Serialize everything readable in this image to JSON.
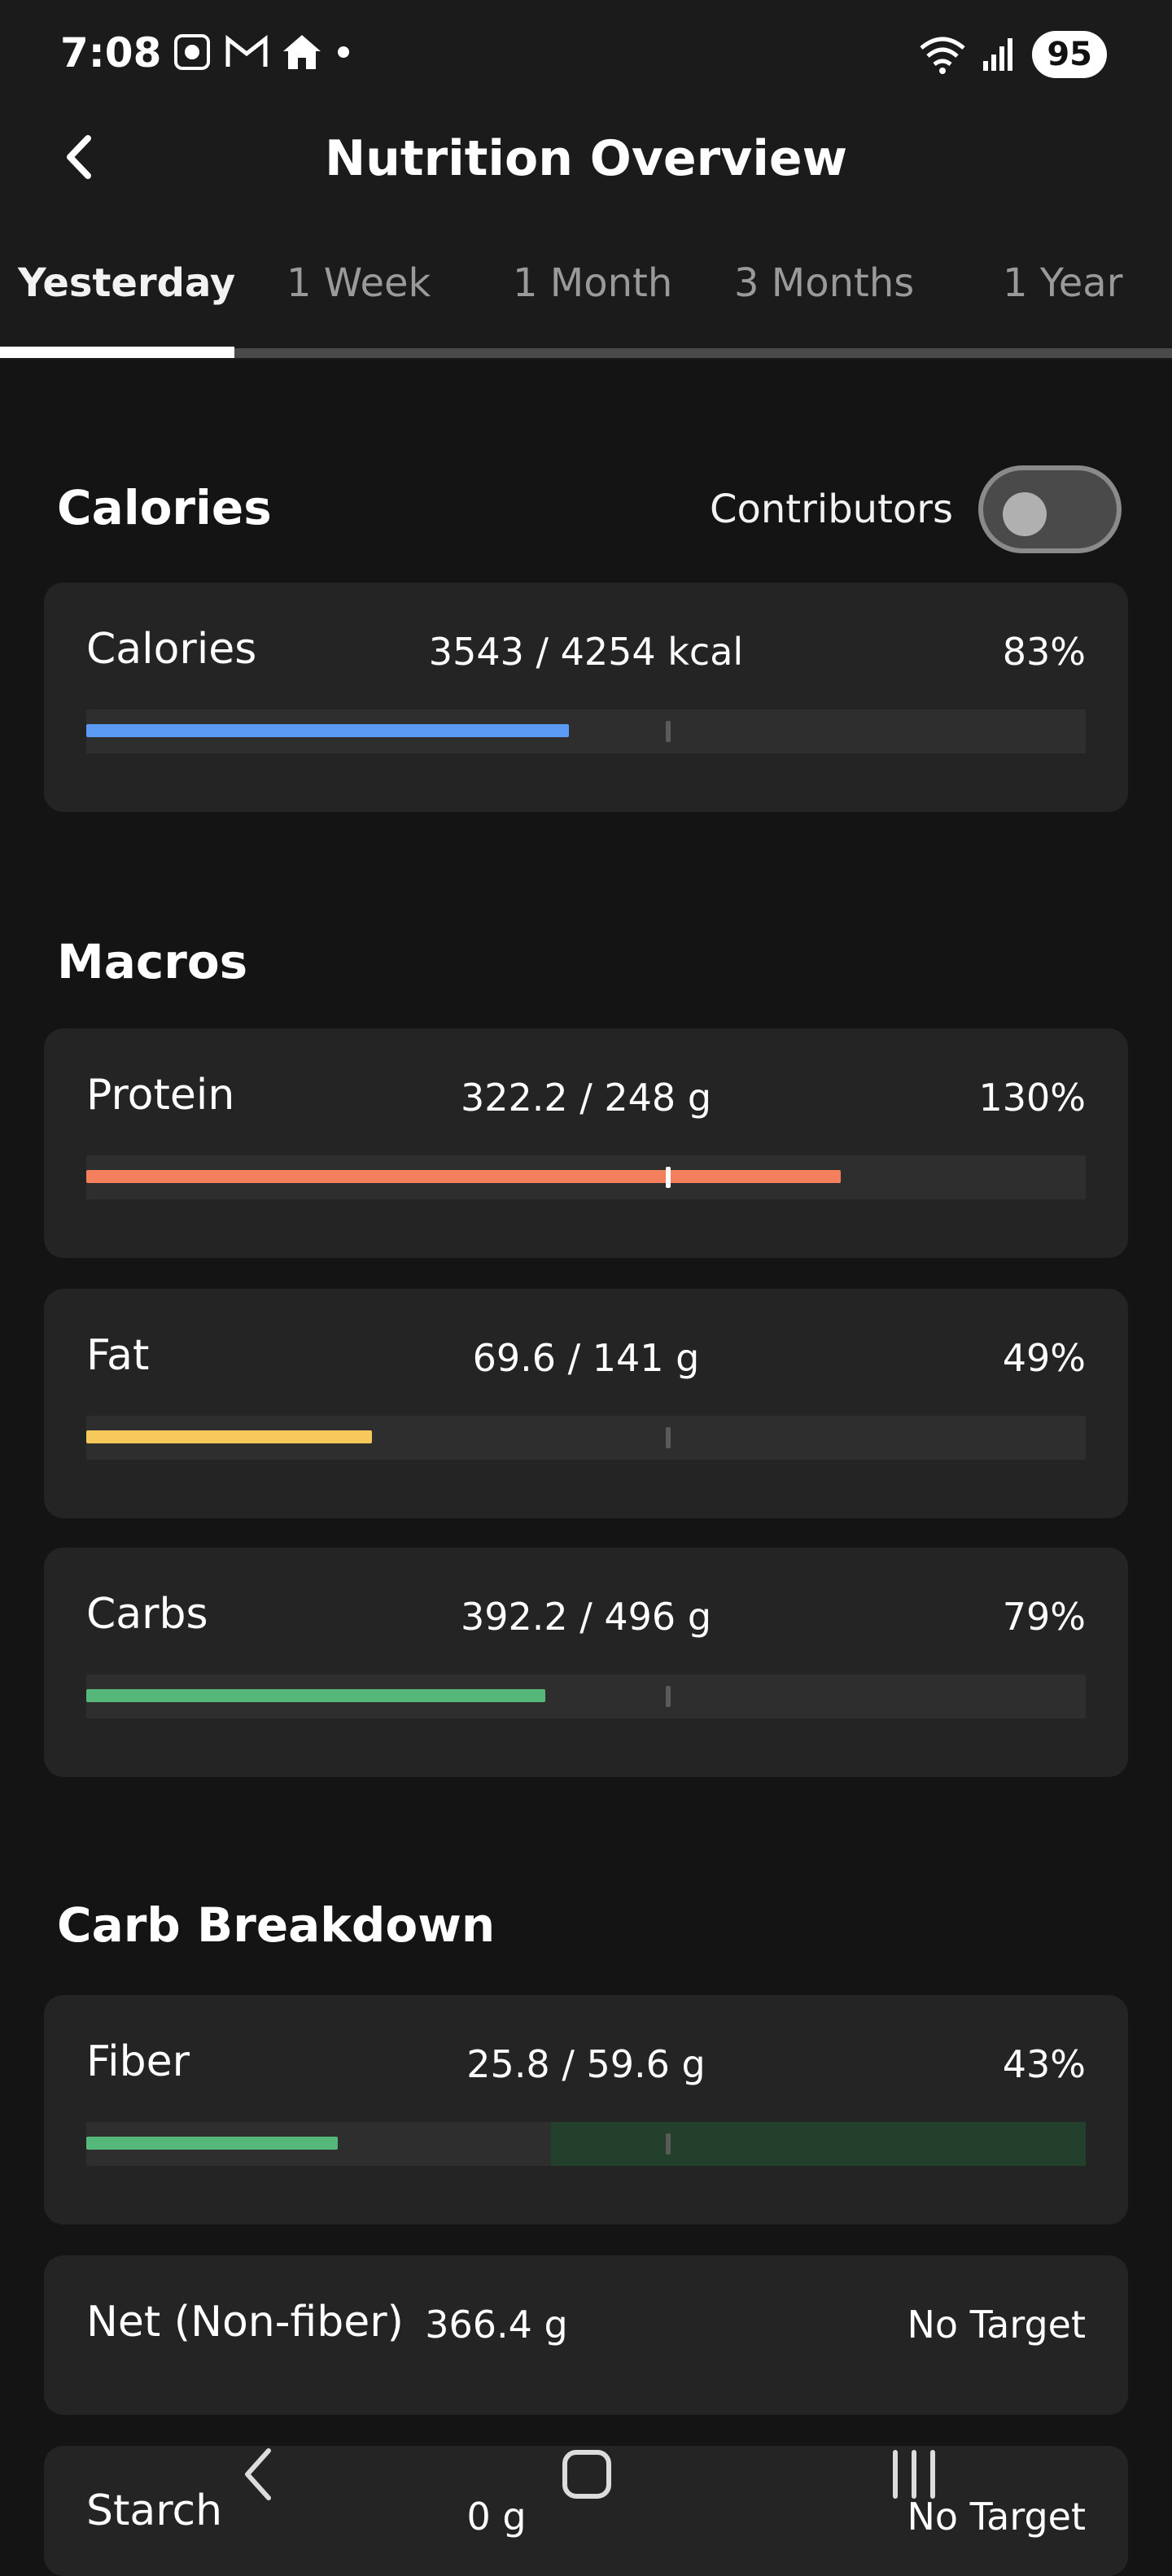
{
  "status_bar": {
    "time": "7:08",
    "icons": [
      "screenshot-icon",
      "gmail-icon",
      "home-icon",
      "dot-icon"
    ],
    "right_icons": [
      "wifi-icon",
      "signal-icon"
    ],
    "battery": "95"
  },
  "header": {
    "title": "Nutrition Overview"
  },
  "tabs": [
    "Yesterday",
    "1 Week",
    "1 Month",
    "3 Months",
    "1 Year"
  ],
  "active_tab": "Yesterday",
  "calories_section": {
    "title": "Calories",
    "contributors_label": "Contributors",
    "contributors_enabled": false,
    "items": [
      {
        "label": "Calories",
        "value": "3543 / 4254 kcal",
        "percent": "83%",
        "fill": 0.483,
        "target": 0.58,
        "color": "#5b9bf5"
      }
    ]
  },
  "macros_section": {
    "title": "Macros",
    "items": [
      {
        "label": "Protein",
        "value": "322.2 / 248 g",
        "percent": "130%",
        "fill": 0.755,
        "target": 0.58,
        "color": "#f47f5c"
      },
      {
        "label": "Fat",
        "value": "69.6 / 141 g",
        "percent": "49%",
        "fill": 0.286,
        "target": 0.58,
        "color": "#f7c85a"
      },
      {
        "label": "Carbs",
        "value": "392.2 / 496 g",
        "percent": "79%",
        "fill": 0.459,
        "target": 0.58,
        "color": "#55b87a"
      }
    ]
  },
  "carb_breakdown_section": {
    "title": "Carb Breakdown",
    "fiber": {
      "label": "Fiber",
      "value": "25.8 / 59.6 g",
      "percent": "43%",
      "fill": 0.252,
      "target": 0.58,
      "color": "#55b87a"
    },
    "net": {
      "label": "Net (Non-fiber)",
      "value": "366.4 g",
      "target_text": "No Target"
    },
    "starch": {
      "label": "Starch",
      "value": "0 g",
      "target_text": "No Target"
    }
  },
  "nav_bar": {
    "icons": [
      "back-nav-icon",
      "home-nav-icon",
      "recents-nav-icon"
    ]
  }
}
